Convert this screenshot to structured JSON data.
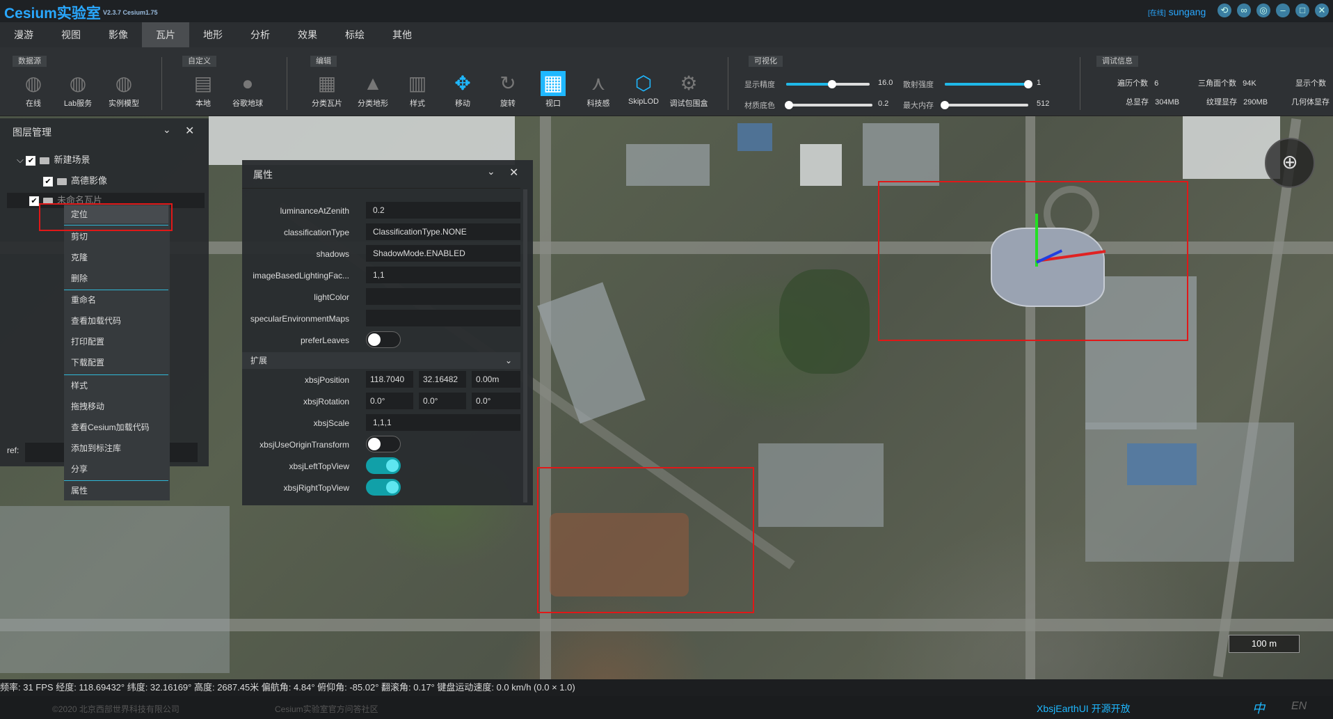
{
  "app": {
    "title": "Cesium实验室",
    "version": "V2.3.7  Cesium1.75"
  },
  "user": {
    "status": "[在线]",
    "name": "sungang"
  },
  "window_buttons": [
    "refresh-icon",
    "link-icon",
    "globe-icon",
    "minimize-icon",
    "maximize-icon",
    "close-icon"
  ],
  "menu": {
    "items": [
      "漫游",
      "视图",
      "影像",
      "瓦片",
      "地形",
      "分析",
      "效果",
      "标绘",
      "其他"
    ],
    "active": "瓦片"
  },
  "toolbar": {
    "groups": [
      "数据源",
      "自定义",
      "编辑",
      "可视化",
      "调试信息"
    ],
    "tools": [
      "在线",
      "Lab服务",
      "实例模型",
      "本地",
      "谷歌地球",
      "分类瓦片",
      "分类地形",
      "样式",
      "移动",
      "旋转",
      "视口",
      "科技感",
      "SkipLOD",
      "调试包围盒"
    ],
    "visual": {
      "display_precision_label": "显示精度",
      "display_precision_value": "16.0",
      "display_precision_level": 0.55,
      "scatter_label": "散射强度",
      "scatter_value": "1",
      "scatter_level": 1.0,
      "material_label": "材质底色",
      "material_value": "0.2",
      "material_level": 0.0,
      "memory_label": "最大内存",
      "memory_value": "512",
      "memory_level": 0.0
    },
    "debug": {
      "traverse_label": "遍历个数",
      "traverse_value": "6",
      "triangles_label": "三角面个数",
      "triangles_value": "94K",
      "display_count_label": "显示个数",
      "total_mem_label": "总显存",
      "total_mem_value": "304MB",
      "texture_mem_label": "纹理显存",
      "texture_mem_value": "290MB",
      "geometry_mem_label": "几何体显存"
    }
  },
  "layer_panel": {
    "title": "图层管理",
    "items": [
      {
        "label": "新建场景",
        "checked": "✔"
      },
      {
        "label": "高德影像",
        "checked": "✔"
      },
      {
        "label": "未命名瓦片",
        "checked": "✔"
      }
    ],
    "ref_label": "ref:"
  },
  "context_menu": {
    "items": [
      "定位",
      "剪切",
      "克隆",
      "删除",
      "重命名",
      "查看加载代码",
      "打印配置",
      "下载配置",
      "样式",
      "拖拽移动",
      "查看Cesium加载代码",
      "添加到标注库",
      "分享",
      "属性"
    ]
  },
  "property_panel": {
    "title": "属性",
    "section_extend": "扩展",
    "rows": {
      "luminanceAtZenith": {
        "label": "luminanceAtZenith",
        "value": "0.2"
      },
      "classificationType": {
        "label": "classificationType",
        "value": "ClassificationType.NONE"
      },
      "shadows": {
        "label": "shadows",
        "value": "ShadowMode.ENABLED"
      },
      "imageBasedLightingFactor": {
        "label": "imageBasedLightingFac...",
        "value": "1,1"
      },
      "lightColor": {
        "label": "lightColor",
        "value": ""
      },
      "specularEnvironmentMaps": {
        "label": "specularEnvironmentMaps",
        "value": ""
      },
      "preferLeaves": {
        "label": "preferLeaves",
        "state": "off"
      },
      "xbsjPosition": {
        "label": "xbsjPosition",
        "values": [
          "118.7040",
          "32.16482",
          "0.00m"
        ]
      },
      "xbsjRotation": {
        "label": "xbsjRotation",
        "values": [
          "0.0°",
          "0.0°",
          "0.0°"
        ]
      },
      "xbsjScale": {
        "label": "xbsjScale",
        "value": "1,1,1"
      },
      "xbsjUseOriginTransform": {
        "label": "xbsjUseOriginTransform",
        "state": "off"
      },
      "xbsjLeftTopView": {
        "label": "xbsjLeftTopView",
        "state": "on"
      },
      "xbsjRightTopView": {
        "label": "xbsjRightTopView",
        "state": "on"
      }
    }
  },
  "map": {
    "scale_label": "100 m"
  },
  "status": {
    "text": "频率: 31 FPS 经度: 118.69432° 纬度: 32.16169° 高度: 2687.45米 偏航角: 4.84° 俯仰角: -85.02° 翻滚角: 0.17° 键盘运动速度: 0.0 km/h (0.0 × 1.0)"
  },
  "footer": {
    "copyright": "©2020 北京西部世界科技有限公司",
    "community": "Cesium实验室官方问答社区",
    "xbsj": "XbsjEarthUI 开源开放",
    "lang_zh": "中",
    "lang_en": "EN"
  },
  "colors": {
    "accent": "#1fb8ff",
    "highlight_box": "#e01818"
  }
}
